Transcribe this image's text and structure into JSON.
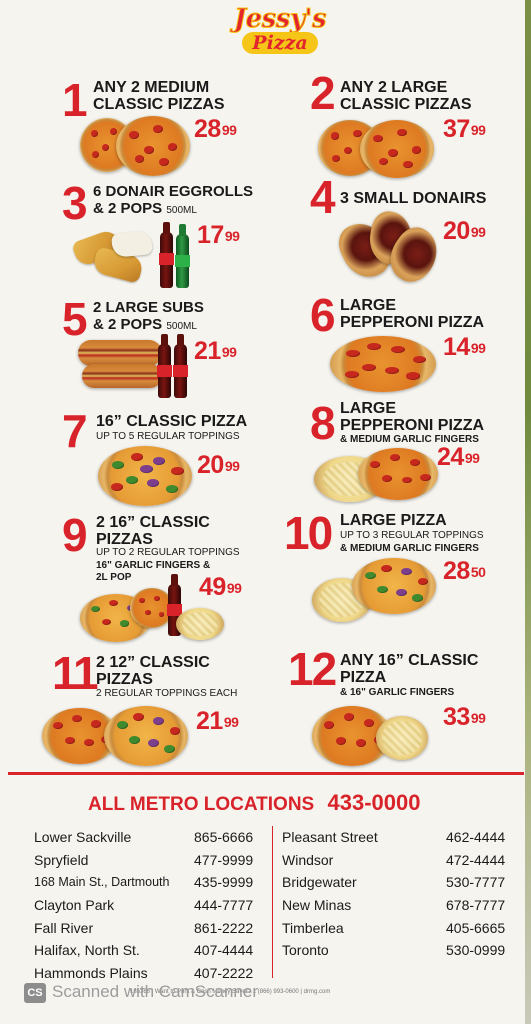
{
  "brand": {
    "line1": "Jessy's",
    "line2": "Pizza"
  },
  "deals": [
    {
      "num": "1",
      "title": [
        "ANY 2 MEDIUM",
        "CLASSIC PIZZAS"
      ],
      "price": "28",
      "cents": "99"
    },
    {
      "num": "2",
      "title": [
        "ANY 2 LARGE",
        "CLASSIC PIZZAS"
      ],
      "price": "37",
      "cents": "99"
    },
    {
      "num": "3",
      "title": [
        "6 DONAIR EGGROLLS",
        "& 2 POPS"
      ],
      "size": "500mL",
      "price": "17",
      "cents": "99"
    },
    {
      "num": "4",
      "title": [
        "3 SMALL DONAIRS"
      ],
      "price": "20",
      "cents": "99"
    },
    {
      "num": "5",
      "title": [
        "2 LARGE SUBS",
        "& 2 POPS"
      ],
      "size": "500mL",
      "price": "21",
      "cents": "99"
    },
    {
      "num": "6",
      "title": [
        "LARGE",
        "PEPPERONI PIZZA"
      ],
      "price": "14",
      "cents": "99"
    },
    {
      "num": "7",
      "title": [
        "16” CLASSIC PIZZA"
      ],
      "note": "UP TO 5 REGULAR TOPPINGS",
      "price": "20",
      "cents": "99"
    },
    {
      "num": "8",
      "title": [
        "LARGE",
        "PEPPERONI PIZZA"
      ],
      "note": "& MEDIUM GARLIC FINGERS",
      "price": "24",
      "cents": "99"
    },
    {
      "num": "9",
      "title": [
        "2 16” CLASSIC",
        "PIZZAS"
      ],
      "note": "UP TO 2 REGULAR TOPPINGS",
      "note2": [
        "16\" GARLIC FINGERS &",
        "2L POP"
      ],
      "price": "49",
      "cents": "99"
    },
    {
      "num": "10",
      "title": [
        "LARGE PIZZA"
      ],
      "note": "UP TO 3 REGULAR TOPPINGS",
      "note2": [
        "& MEDIUM GARLIC FINGERS"
      ],
      "price": "28",
      "cents": "50"
    },
    {
      "num": "11",
      "title": [
        "2 12” CLASSIC",
        "PIZZAS"
      ],
      "note": "2 REGULAR TOPPINGS EACH",
      "price": "21",
      "cents": "99"
    },
    {
      "num": "12",
      "title": [
        "ANY 16” CLASSIC",
        "PIZZA"
      ],
      "note": "& 16\" GARLIC FINGERS",
      "price": "33",
      "cents": "99"
    }
  ],
  "footer": {
    "heading": "ALL METRO LOCATIONS",
    "phone": "433-0000",
    "left": [
      {
        "name": "Lower Sackville",
        "tel": "865-6666"
      },
      {
        "name": "Spryfield",
        "tel": "477-9999"
      },
      {
        "name": "168 Main St., Dartmouth",
        "tel": "435-9999"
      },
      {
        "name": "Clayton Park",
        "tel": "444-7777"
      },
      {
        "name": "Fall River",
        "tel": "861-2222"
      },
      {
        "name": "Halifax, North St.",
        "tel": "407-4444"
      },
      {
        "name": "Hammonds Plains",
        "tel": "407-2222"
      }
    ],
    "right": [
      {
        "name": "Pleasant Street",
        "tel": "462-4444"
      },
      {
        "name": "Windsor",
        "tel": "472-4444"
      },
      {
        "name": "Bridgewater",
        "tel": "530-7777"
      },
      {
        "name": "New Minas",
        "tel": "678-7777"
      },
      {
        "name": "Timberlea",
        "tel": "405-6665"
      },
      {
        "name": "Toronto",
        "tel": "530-0999"
      }
    ]
  },
  "scan": {
    "badge": "CS",
    "text": "Scanned with CamScanner",
    "fine": "185368 | Want to Print & Cash Money Saver? 1 (866) 993-0600 | drmg.com"
  }
}
